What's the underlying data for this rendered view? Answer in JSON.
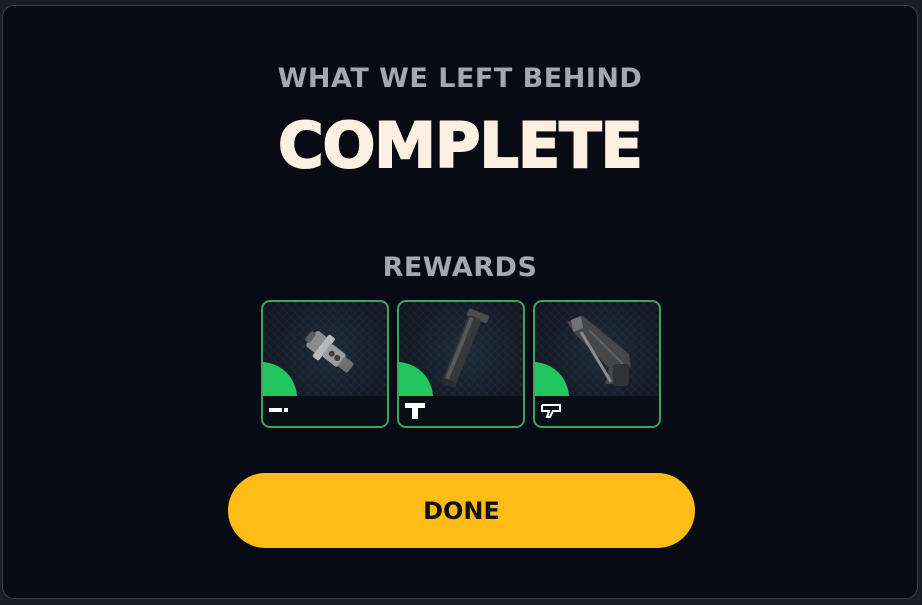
{
  "modal": {
    "subtitle": "WHAT WE LEFT BEHIND",
    "title": "COMPLETE",
    "rewards_label": "REWARDS",
    "done_label": "DONE"
  },
  "rewards": [
    {
      "name": "muzzle-attachment",
      "icon": "muzzle-icon",
      "rarity": "uncommon"
    },
    {
      "name": "foregrip-attachment",
      "icon": "grip-icon",
      "rarity": "uncommon"
    },
    {
      "name": "stock-attachment",
      "icon": "stock-icon",
      "rarity": "uncommon"
    }
  ],
  "colors": {
    "background": "#090b14",
    "title": "#fbefe2",
    "subtitle": "#a5a8ae",
    "accent_button": "#ffbb16",
    "rarity_uncommon": "#22c55e",
    "card_border": "#3aa561"
  }
}
